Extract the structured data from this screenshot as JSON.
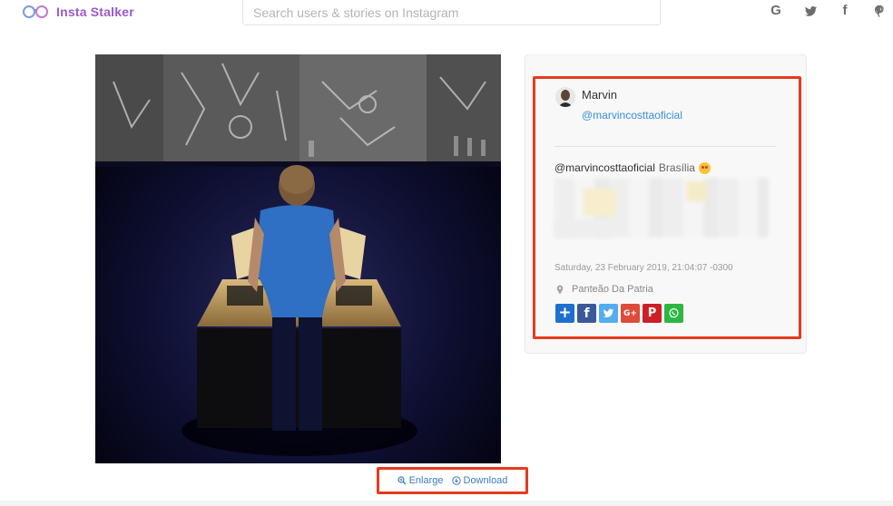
{
  "header": {
    "logo_text": "Insta Stalker",
    "search_placeholder": "Search users & stories on Instagram",
    "social_links": [
      {
        "label": "G",
        "icon": "google-icon"
      },
      {
        "label": "t",
        "icon": "twitter-icon"
      },
      {
        "label": "f",
        "icon": "facebook-icon"
      },
      {
        "label": "p",
        "icon": "pinterest-icon"
      }
    ]
  },
  "photo_actions": {
    "enlarge": "Enlarge",
    "download": "Download"
  },
  "post": {
    "user_name": "Marvin",
    "user_handle": "@marvincosttaoficial",
    "caption_mention": "@marvincosttaoficial",
    "caption_place": "Brasília",
    "date": "Saturday, 23 February 2019, 21:04:07 -0300",
    "location": "Panteão Da Patria"
  },
  "share_buttons": [
    {
      "name": "addthis",
      "color": "#1f6fd0",
      "label": "+"
    },
    {
      "name": "facebook",
      "color": "#3b5998",
      "label": "f"
    },
    {
      "name": "twitter",
      "color": "#55acee",
      "label": ""
    },
    {
      "name": "google-plus",
      "color": "#dd4b39",
      "label": "G+"
    },
    {
      "name": "pinterest",
      "color": "#cb2027",
      "label": "P"
    },
    {
      "name": "whatsapp",
      "color": "#2cb742",
      "label": ""
    }
  ],
  "colors": {
    "brand": "#9b59c8",
    "link": "#3a8ed8",
    "highlight_box": "#e53a1e"
  }
}
